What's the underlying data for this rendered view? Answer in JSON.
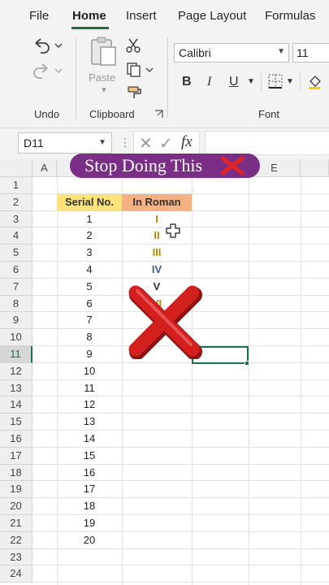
{
  "ribbon_tabs": [
    {
      "label": "File",
      "active": false
    },
    {
      "label": "Home",
      "active": true
    },
    {
      "label": "Insert",
      "active": false
    },
    {
      "label": "Page Layout",
      "active": false
    },
    {
      "label": "Formulas",
      "active": false
    }
  ],
  "ribbon": {
    "paste_label": "Paste",
    "undo_group": "Undo",
    "clipboard_group": "Clipboard",
    "font_group": "Font",
    "font_name": "Calibri",
    "font_size": "11",
    "bold": "B",
    "italic": "I",
    "underline": "U"
  },
  "formula_bar": {
    "name_box": "D11",
    "fx": "fx",
    "value": ""
  },
  "grid": {
    "columns": [
      "A",
      "B",
      "C",
      "D",
      "E"
    ],
    "rows": [
      "1",
      "2",
      "3",
      "4",
      "5",
      "6",
      "7",
      "8",
      "9",
      "10",
      "11",
      "12",
      "13",
      "14",
      "15",
      "16",
      "17",
      "18",
      "19",
      "20",
      "21",
      "22",
      "23",
      "24"
    ],
    "selected_row": "11",
    "selected_cell": "D11",
    "header_serial": "Serial No.",
    "header_roman": "In Roman",
    "serials": [
      "1",
      "2",
      "3",
      "4",
      "5",
      "6",
      "7",
      "8",
      "9",
      "10",
      "11",
      "12",
      "13",
      "14",
      "15",
      "16",
      "17",
      "18",
      "19",
      "20"
    ],
    "romans": [
      "I",
      "II",
      "III",
      "IV",
      "V",
      "VI"
    ]
  },
  "overlay": {
    "banner_text": "Stop Doing This",
    "banner_color": "#7a2e86",
    "cross_color": "#d41f1f"
  },
  "colors": {
    "accent": "#1e7145",
    "header_yellow": "#ffe27a",
    "header_orange": "#f6b183"
  }
}
